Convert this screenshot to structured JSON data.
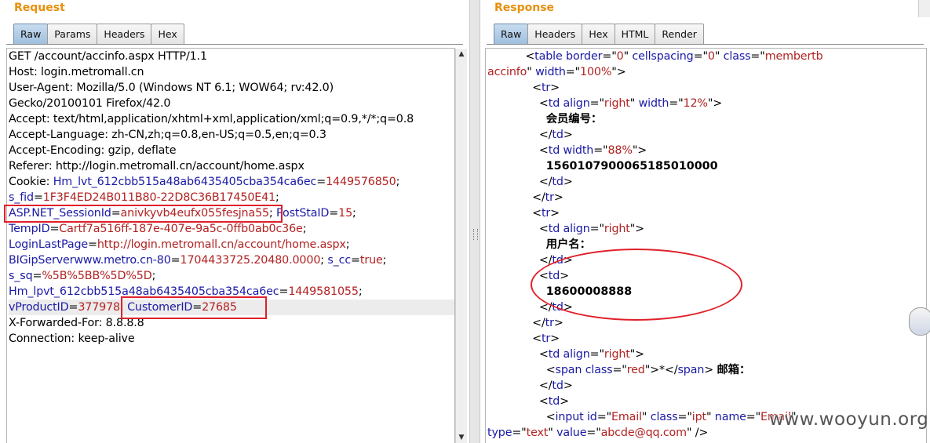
{
  "request": {
    "title": "Request",
    "tabs": [
      "Raw",
      "Params",
      "Headers",
      "Hex"
    ],
    "active_tab": "Raw",
    "lines": {
      "l1": "GET /account/accinfo.aspx HTTP/1.1",
      "l2": "Host: login.metromall.cn",
      "l3": "User-Agent: Mozilla/5.0 (Windows NT 6.1; WOW64; rv:42.0)",
      "l4": "Gecko/20100101 Firefox/42.0",
      "l5": "Accept: text/html,application/xhtml+xml,application/xml;q=0.9,*/*;q=0.8",
      "l6": "Accept-Language: zh-CN,zh;q=0.8,en-US;q=0.5,en;q=0.3",
      "l7": "Accept-Encoding: gzip, deflate",
      "l8": "Referer: http://login.metromall.cn/account/home.aspx",
      "l9_prefix": "Cookie: ",
      "l9_key": "Hm_lvt_612cbb515a48ab6435405cba354ca6ec",
      "l9_val": "1449576850",
      "l10_key": "s_fid",
      "l10_val": "1F3F4ED24B011B80-22D8C36B17450E41",
      "l11_key": "ASP.NET_SessionId",
      "l11_val": "anivkyvb4eufx055fesjna55",
      "l11_key2": "PostStaID",
      "l11_val2": "15",
      "l12_key": "TempID",
      "l12_val": "Cartf7a516ff-187e-407e-9a5c-0ffb0ab0c36e",
      "l13_key": "LoginLastPage",
      "l13_val": "http://login.metromall.cn/account/home.aspx",
      "l14_key": "BIGipServerwww.metro.cn-80",
      "l14_val": "1704433725.20480.0000",
      "l14_key2": "s_cc",
      "l14_val2": "true",
      "l15_key": "s_sq",
      "l15_val": "%5B%5BB%5D%5D",
      "l16_key": "Hm_lpvt_612cbb515a48ab6435405cba354ca6ec",
      "l16_val": "1449581055",
      "l17_key": "vProductID",
      "l17_val": "377978",
      "l17_key2": "CustomerID",
      "l17_val2": "27685",
      "l18": "X-Forwarded-For: 8.8.8.8",
      "l19": "Connection: keep-alive"
    }
  },
  "response": {
    "title": "Response",
    "tabs": [
      "Raw",
      "Headers",
      "Hex",
      "HTML",
      "Render"
    ],
    "active_tab": "Raw",
    "code": {
      "table_tag": "table",
      "attr_border": "border",
      "val_border": "0",
      "attr_cellspacing": "cellspacing",
      "val_cellspacing": "0",
      "attr_class": "class",
      "val_class_1": "membertb",
      "val_class_2": "accinfo",
      "attr_width": "width",
      "val_width_100": "100%",
      "tr_tag": "tr",
      "td_tag": "td",
      "attr_align": "align",
      "val_right": "right",
      "val_12": "12%",
      "val_88": "88%",
      "label_member_no": "会员编号：",
      "member_no": "1560107900065185010000",
      "label_username": "用户名：",
      "username": "18600008888",
      "span_tag": "span",
      "val_red": "red",
      "asterisk": "*",
      "label_email": "邮箱：",
      "input_tag": "input",
      "attr_id": "id",
      "val_email_id": "Email",
      "val_ipt": "ipt",
      "attr_name": "name",
      "val_email_name": "Email",
      "attr_type": "type",
      "val_text": "text",
      "attr_value": "value",
      "val_email": "abcde@qq.com"
    }
  },
  "watermark": "www.wooyun.org"
}
